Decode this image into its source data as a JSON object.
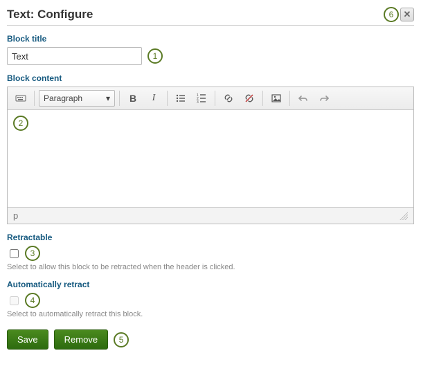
{
  "header": {
    "title": "Text: Configure"
  },
  "markers": {
    "m1": "1",
    "m2": "2",
    "m3": "3",
    "m4": "4",
    "m5": "5",
    "m6": "6"
  },
  "close": {
    "glyph": "✕"
  },
  "block_title": {
    "label": "Block title",
    "value": "Text"
  },
  "block_content": {
    "label": "Block content"
  },
  "toolbar": {
    "format_value": "Paragraph",
    "chevron": "▾"
  },
  "editor": {
    "path": "p"
  },
  "retractable": {
    "label": "Retractable",
    "help": "Select to allow this block to be retracted when the header is clicked."
  },
  "auto_retract": {
    "label": "Automatically retract",
    "help": "Select to automatically retract this block."
  },
  "buttons": {
    "save": "Save",
    "remove": "Remove"
  }
}
